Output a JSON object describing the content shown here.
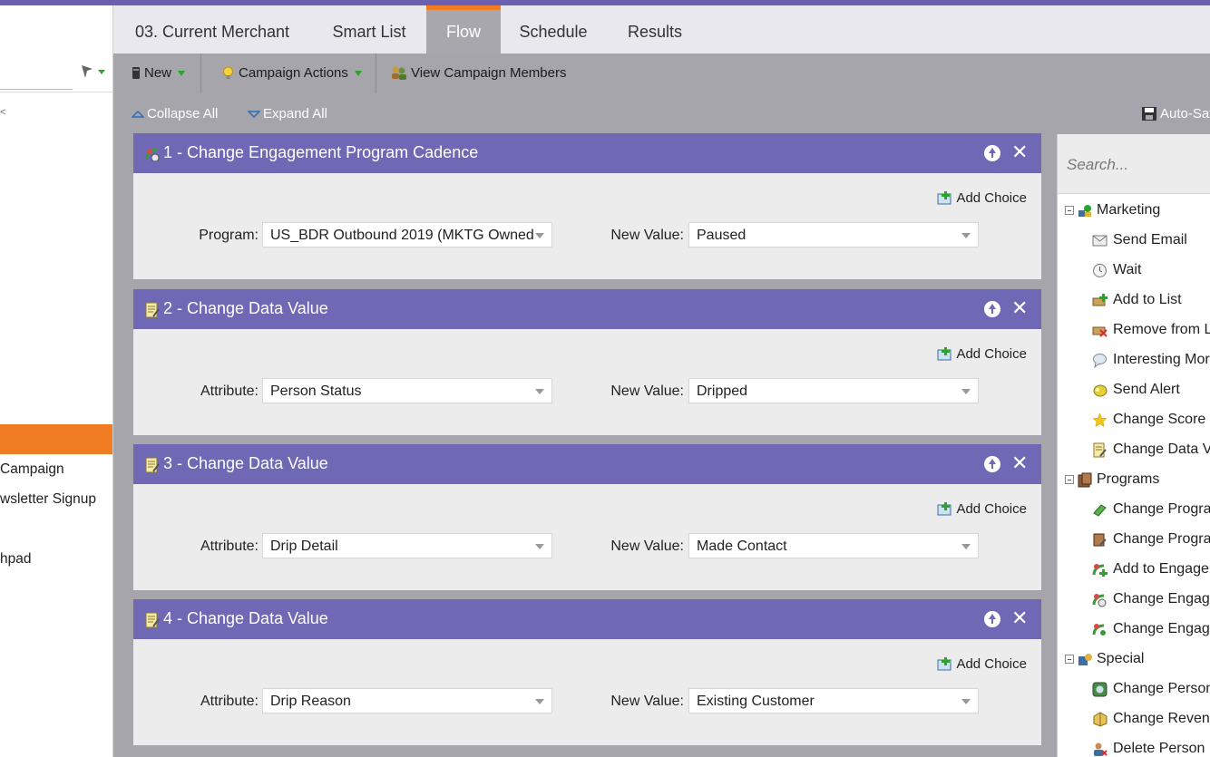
{
  "tabs": [
    {
      "label": "03. Current Merchant",
      "active": false
    },
    {
      "label": "Smart List",
      "active": false
    },
    {
      "label": "Flow",
      "active": true
    },
    {
      "label": "Schedule",
      "active": false
    },
    {
      "label": "Results",
      "active": false
    }
  ],
  "toolbar": {
    "new_label": "New",
    "campaign_actions_label": "Campaign Actions",
    "view_members_label": "View Campaign Members"
  },
  "canvas_controls": {
    "collapse_all": "Collapse All",
    "expand_all": "Expand All",
    "auto_save": "Auto-Sav"
  },
  "left_panel": {
    "items": [
      " Campaign",
      "wsletter Signup",
      "hpad"
    ]
  },
  "steps": [
    {
      "title": "1 - Change Engagement Program Cadence",
      "add_choice": "Add Choice",
      "field_label": "Program:",
      "field_value": "US_BDR Outbound 2019 (MKTG Owned",
      "new_value_label": "New Value:",
      "new_value": "Paused"
    },
    {
      "title": "2 - Change Data Value",
      "add_choice": "Add Choice",
      "field_label": "Attribute:",
      "field_value": "Person Status",
      "new_value_label": "New Value:",
      "new_value": "Dripped"
    },
    {
      "title": "3 - Change Data Value",
      "add_choice": "Add Choice",
      "field_label": "Attribute:",
      "field_value": "Drip Detail",
      "new_value_label": "New Value:",
      "new_value": "Made Contact"
    },
    {
      "title": "4 - Change Data Value",
      "add_choice": "Add Choice",
      "field_label": "Attribute:",
      "field_value": "Drip Reason",
      "new_value_label": "New Value:",
      "new_value": "Existing Customer"
    }
  ],
  "palette": {
    "search_placeholder": "Search...",
    "groups": [
      {
        "label": "Marketing",
        "items": [
          "Send Email",
          "Wait",
          "Add to List",
          "Remove from L",
          "Interesting Mor",
          "Send Alert",
          "Change Score",
          "Change Data Va"
        ]
      },
      {
        "label": "Programs",
        "items": [
          "Change Progra",
          "Change Progra",
          "Add to Engager",
          "Change Engage",
          "Change Engage"
        ]
      },
      {
        "label": "Special",
        "items": [
          "Change Person",
          "Change Revenu",
          "Delete Person"
        ]
      }
    ]
  },
  "colors": {
    "accent_orange": "#ef7b23",
    "step_header": "#6f68b4",
    "top_bar": "#6b5fb0",
    "canvas_bg": "#a5a5ab"
  }
}
